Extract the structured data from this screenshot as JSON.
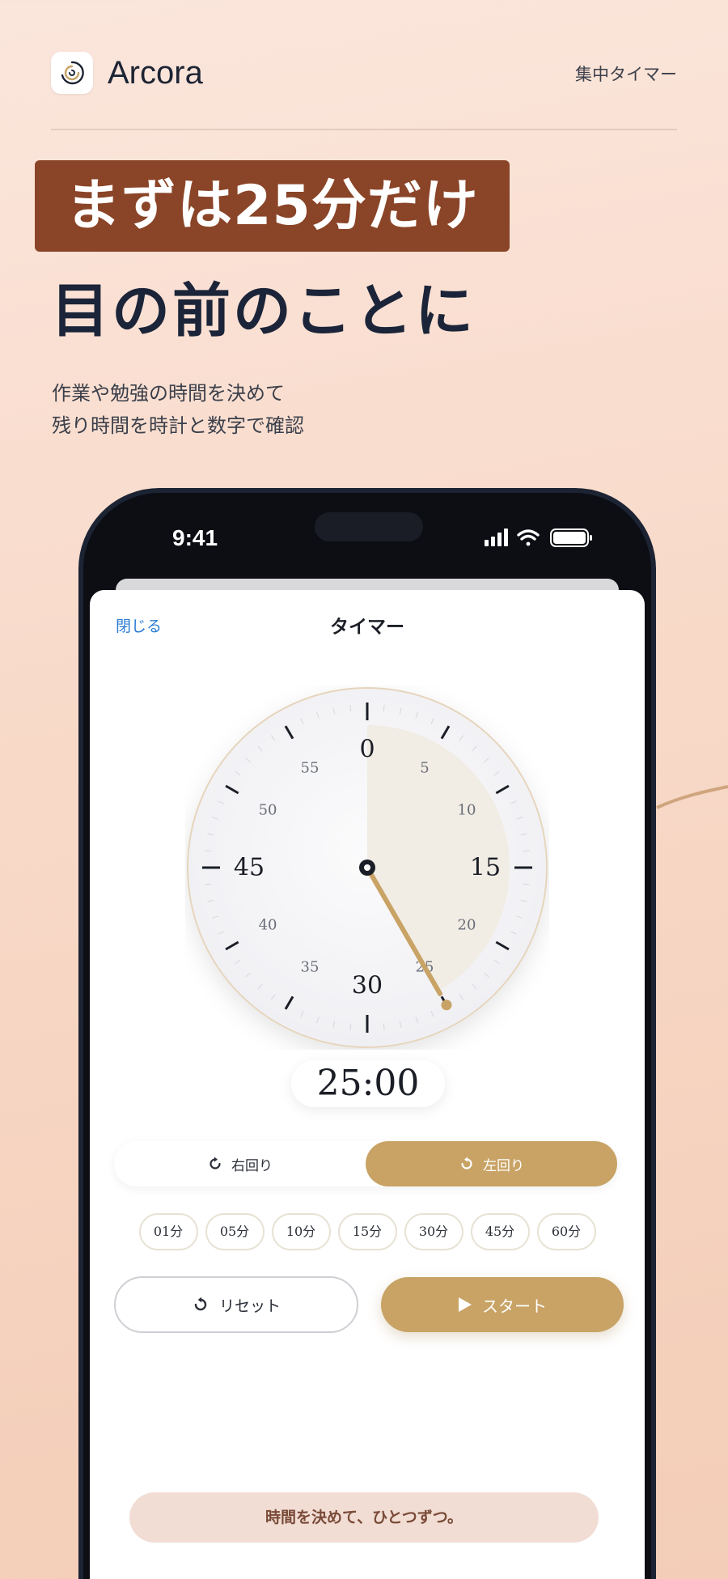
{
  "header": {
    "app_name": "Arcora",
    "link_label": "集中タイマー"
  },
  "hero": {
    "headline_highlight": "まずは25分だけ",
    "headline_second": "目の前のことに",
    "sub_line1": "作業や勉強の時間を決めて",
    "sub_line2": "残り時間を時計と数字で確認"
  },
  "colors": {
    "accent_gold": "#c8a365",
    "badge_brown": "#8a4427",
    "link_blue": "#2b7bd4"
  },
  "statusbar": {
    "time": "9:41",
    "icons": [
      "signal-icon",
      "wifi-icon",
      "battery-icon"
    ]
  },
  "sheet": {
    "close_label": "閉じる",
    "title": "タイマー"
  },
  "dial": {
    "major_labels": [
      "0",
      "15",
      "30",
      "45"
    ],
    "minor_labels": [
      "5",
      "10",
      "20",
      "25",
      "35",
      "40",
      "50",
      "55"
    ],
    "set_minutes": 25,
    "max_minutes": 60
  },
  "timer": {
    "display": "25:00"
  },
  "direction": {
    "clockwise_label": "右回り",
    "counter_label": "左回り",
    "selected": "counter"
  },
  "presets": [
    "01分",
    "05分",
    "10分",
    "15分",
    "30分",
    "45分",
    "60分"
  ],
  "actions": {
    "reset_label": "リセット",
    "start_label": "スタート"
  },
  "caption": "時間を決めて、ひとつずつ。"
}
